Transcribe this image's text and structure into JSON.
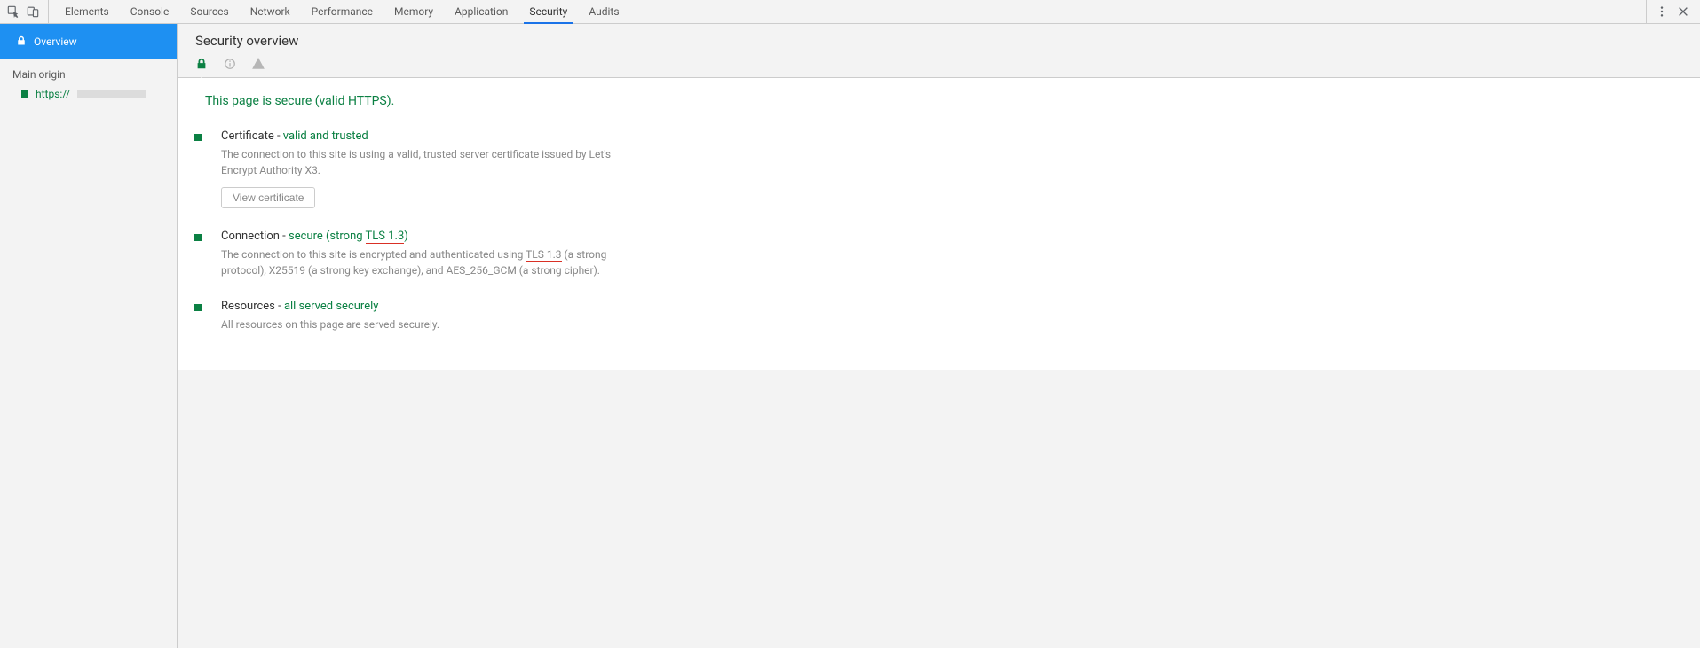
{
  "tabs": {
    "items": [
      "Elements",
      "Console",
      "Sources",
      "Network",
      "Performance",
      "Memory",
      "Application",
      "Security",
      "Audits"
    ],
    "active_index": 7
  },
  "sidebar": {
    "overview_label": "Overview",
    "section_label": "Main origin",
    "origin_prefix": "https://"
  },
  "header": {
    "title": "Security overview"
  },
  "overview": {
    "page_status": "This page is secure (valid HTTPS).",
    "sections": [
      {
        "title_prefix": "Certificate",
        "dash": " - ",
        "status_text": "valid and trusted",
        "description_1": "The connection to this site is using a valid, trusted server certificate issued by Let's Encrypt Authority X3.",
        "button": "View certificate"
      },
      {
        "title_prefix": "Connection",
        "dash": " - ",
        "status_text_pre": "secure (strong ",
        "status_text_tls": "TLS 1.3",
        "status_text_post": ")",
        "description_pre": "The connection to this site is encrypted and authenticated using ",
        "description_tls": "TLS 1.3",
        "description_post": " (a strong protocol), X25519 (a strong key exchange), and AES_256_GCM (a strong cipher)."
      },
      {
        "title_prefix": "Resources",
        "dash": " - ",
        "status_text": "all served securely",
        "description_1": "All resources on this page are served securely."
      }
    ]
  }
}
